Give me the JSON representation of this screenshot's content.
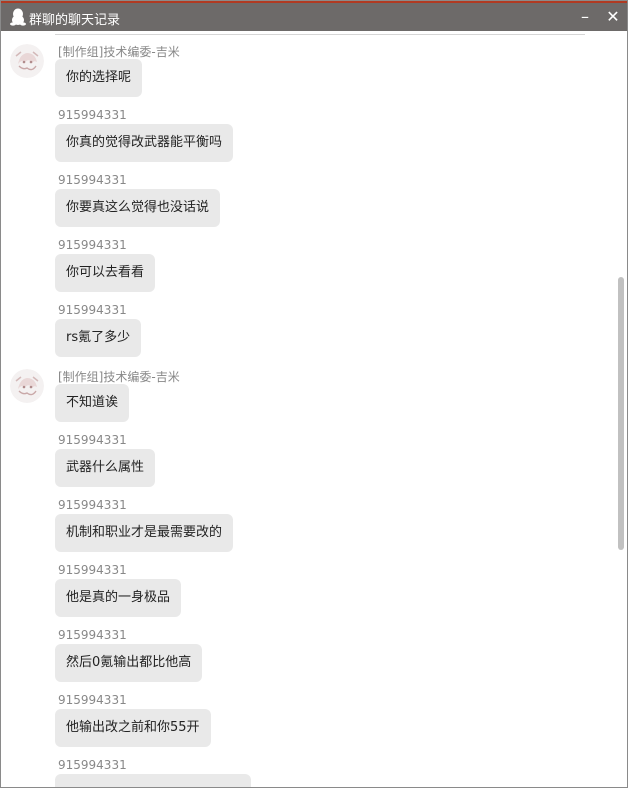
{
  "window": {
    "title": "群聊的聊天记录",
    "minimize_label": "–",
    "close_label": "✕",
    "icon": "qq-penguin-icon"
  },
  "messages": [
    {
      "sender": "[制作组]技术编委-吉米",
      "text": "你的选择呢",
      "avatar": true
    },
    {
      "sender": "915994331",
      "text": "你真的觉得改武器能平衡吗",
      "avatar": false
    },
    {
      "sender": "915994331",
      "text": "你要真这么觉得也没话说",
      "avatar": false
    },
    {
      "sender": "915994331",
      "text": "你可以去看看",
      "avatar": false
    },
    {
      "sender": "915994331",
      "text": "rs氪了多少",
      "avatar": false
    },
    {
      "sender": "[制作组]技术编委-吉米",
      "text": "不知道诶",
      "avatar": true
    },
    {
      "sender": "915994331",
      "text": "武器什么属性",
      "avatar": false
    },
    {
      "sender": "915994331",
      "text": "机制和职业才是最需要改的",
      "avatar": false
    },
    {
      "sender": "915994331",
      "text": "他是真的一身极品",
      "avatar": false
    },
    {
      "sender": "915994331",
      "text": "然后0氪输出都比他高",
      "avatar": false
    },
    {
      "sender": "915994331",
      "text": "他输出改之前和你55开",
      "avatar": false
    },
    {
      "sender": "915994331",
      "text": "",
      "avatar": false
    }
  ],
  "colors": {
    "titlebar": "#6d6a69",
    "accent_top": "#b03a22",
    "bubble": "#e9e9e9",
    "sender": "#888888"
  }
}
